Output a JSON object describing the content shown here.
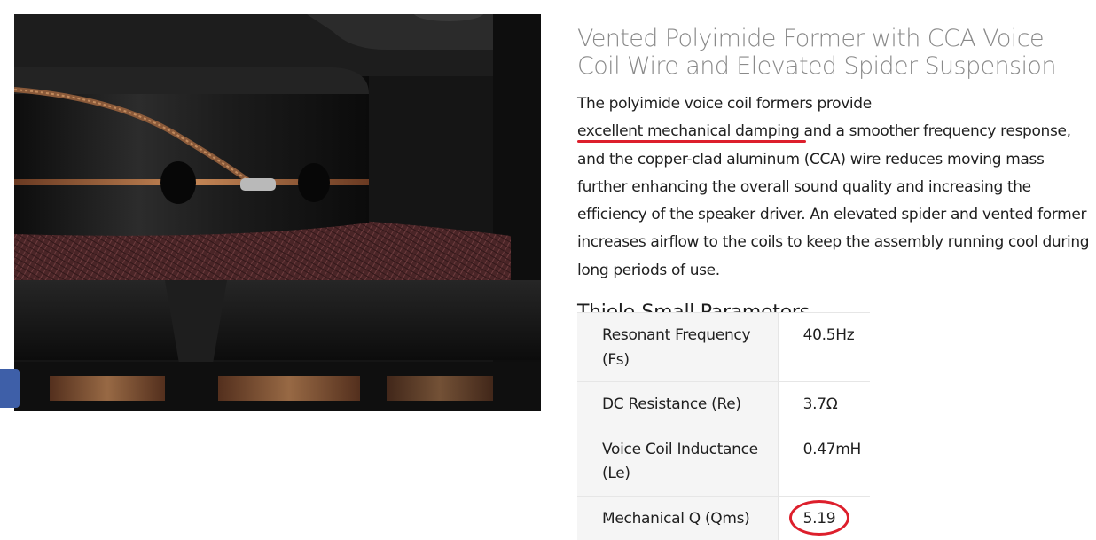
{
  "product_image": {
    "alt": "Speaker voice coil close-up"
  },
  "article": {
    "title": "Vented Polyimide Former with CCA Voice Coil Wire and Elevated Spider Suspension",
    "description_before": "The polyimide voice coil formers provide ",
    "description_highlight": "excellent mechanical damping",
    "description_after": " and a smoother frequency response, and the copper-clad aluminum (CCA) wire reduces moving mass further enhancing the overall sound quality and increasing the efficiency of the speaker driver. An elevated spider and vented former increases airflow to the coils to keep the assembly running cool during long periods of use.",
    "highlight_color": "#dd1f2c"
  },
  "parameters": {
    "heading": "Thiele-Small Parameters",
    "rows": [
      {
        "label": "Resonant Frequency (Fs)",
        "value": "40.5Hz"
      },
      {
        "label": "DC Resistance (Re)",
        "value": "3.7Ω"
      },
      {
        "label": "Voice Coil Inductance (Le)",
        "value": "0.47mH"
      },
      {
        "label": "Mechanical Q (Qms)",
        "value": "5.19"
      }
    ]
  },
  "colors": {
    "title": "#8a8a8a",
    "annotation_red": "#dd1f2c",
    "side_tab": "#3e5fa8",
    "table_label_bg": "#f5f5f5"
  }
}
